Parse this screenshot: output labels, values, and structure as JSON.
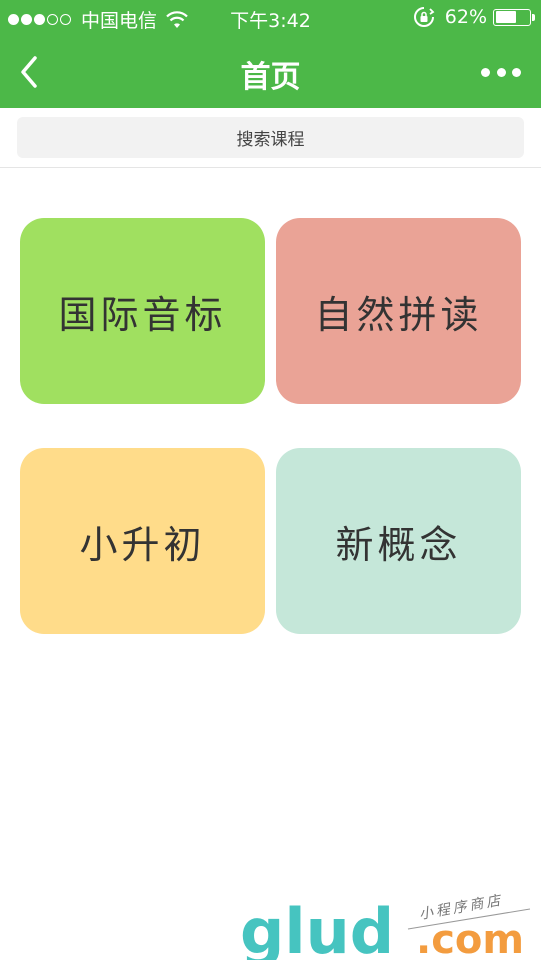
{
  "status_bar": {
    "carrier": "中国电信",
    "time": "下午3:42",
    "battery_percent": "62%",
    "battery_level": 0.62,
    "signal_bars_filled": 3,
    "signal_bars_total": 5
  },
  "nav": {
    "title": "首页",
    "back_icon": "chevron-left-icon",
    "more_icon": "more-dots-icon"
  },
  "search": {
    "placeholder": "搜索课程"
  },
  "tiles": [
    {
      "label": "国际音标",
      "color": "#a0e060"
    },
    {
      "label": "自然拼读",
      "color": "#eaa396"
    },
    {
      "label": "小升初",
      "color": "#ffdc8a"
    },
    {
      "label": "新概念",
      "color": "#c5e7d9"
    }
  ],
  "watermark": {
    "brand": "glud",
    "domain": ".com",
    "tagline": "小程序商店"
  },
  "colors": {
    "theme": "#4cb848"
  }
}
